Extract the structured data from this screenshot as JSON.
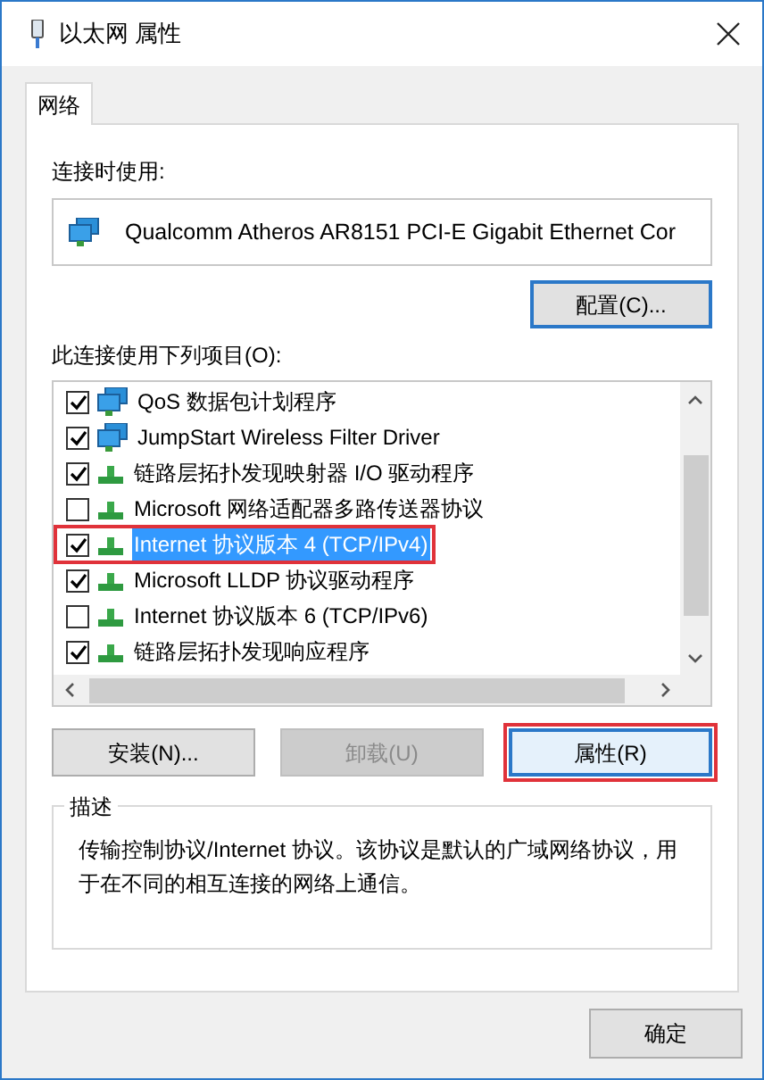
{
  "window": {
    "title": "以太网 属性"
  },
  "tabs": [
    {
      "label": "网络",
      "selected": true
    }
  ],
  "connect_using": {
    "label": "连接时使用:",
    "adapter": "Qualcomm Atheros AR8151 PCI-E Gigabit Ethernet Cor",
    "configure_button": "配置(C)..."
  },
  "items_label": "此连接使用下列项目(O):",
  "items": [
    {
      "kind": "service",
      "label": "QoS 数据包计划程序",
      "checked": true,
      "selected": false,
      "highlighted": false
    },
    {
      "kind": "service",
      "label": "JumpStart Wireless Filter Driver",
      "checked": true,
      "selected": false,
      "highlighted": false
    },
    {
      "kind": "protocol",
      "label": "链路层拓扑发现映射器 I/O 驱动程序",
      "checked": true,
      "selected": false,
      "highlighted": false
    },
    {
      "kind": "protocol",
      "label": "Microsoft 网络适配器多路传送器协议",
      "checked": false,
      "selected": false,
      "highlighted": false
    },
    {
      "kind": "protocol",
      "label": "Internet 协议版本 4 (TCP/IPv4)",
      "checked": true,
      "selected": true,
      "highlighted": true
    },
    {
      "kind": "protocol",
      "label": "Microsoft LLDP 协议驱动程序",
      "checked": true,
      "selected": false,
      "highlighted": false
    },
    {
      "kind": "protocol",
      "label": "Internet 协议版本 6 (TCP/IPv6)",
      "checked": false,
      "selected": false,
      "highlighted": false
    },
    {
      "kind": "protocol",
      "label": "链路层拓扑发现响应程序",
      "checked": true,
      "selected": false,
      "highlighted": false
    }
  ],
  "item_buttons": [
    {
      "label": "安装(N)...",
      "disabled": false,
      "focused": false,
      "highlighted": false
    },
    {
      "label": "卸载(U)",
      "disabled": true,
      "focused": false,
      "highlighted": false
    },
    {
      "label": "属性(R)",
      "disabled": false,
      "focused": true,
      "highlighted": true
    }
  ],
  "description": {
    "legend": "描述",
    "text": "传输控制协议/Internet 协议。该协议是默认的广域网络协议，用于在不同的相互连接的网络上通信。"
  },
  "dialog_buttons": [
    {
      "label": "确定"
    }
  ]
}
